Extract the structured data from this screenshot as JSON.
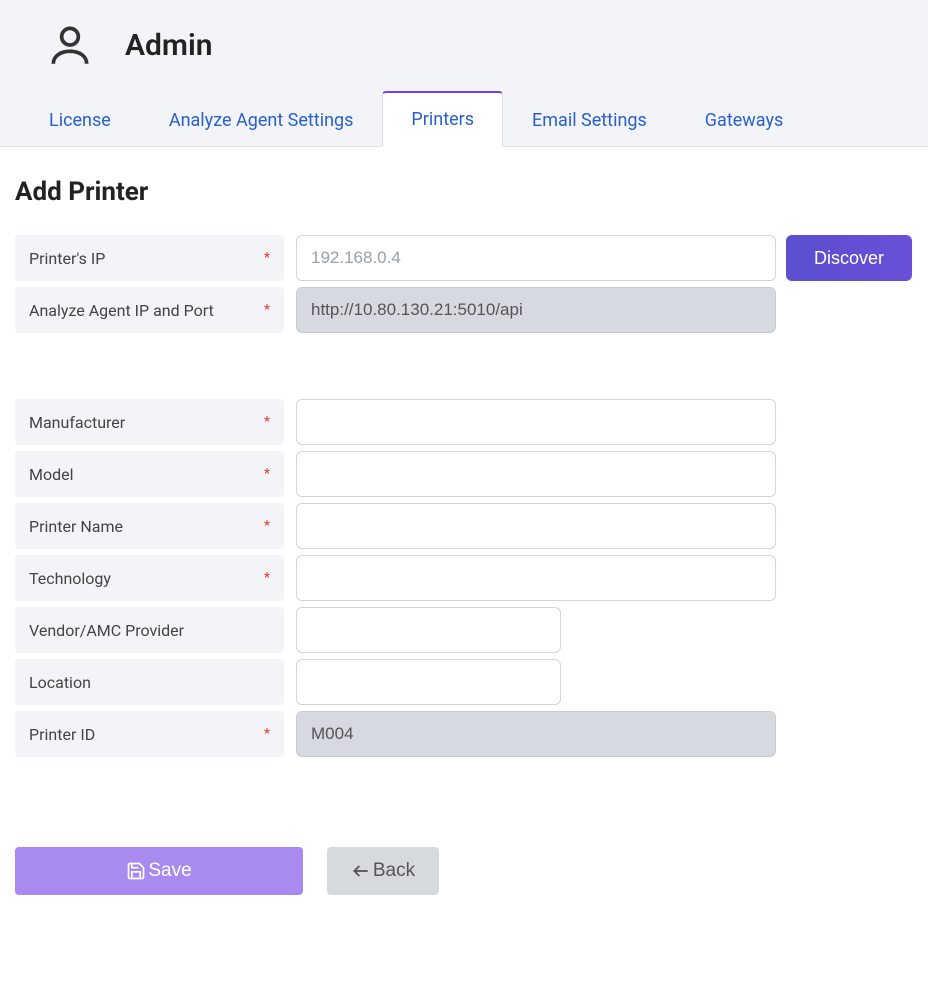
{
  "header": {
    "title": "Admin"
  },
  "tabs": [
    {
      "label": "License"
    },
    {
      "label": "Analyze Agent Settings"
    },
    {
      "label": "Printers"
    },
    {
      "label": "Email Settings"
    },
    {
      "label": "Gateways"
    }
  ],
  "form": {
    "section_title": "Add Printer",
    "labels": {
      "printer_ip": "Printer's IP",
      "agent_ip": "Analyze Agent IP and Port",
      "manufacturer": "Manufacturer",
      "model": "Model",
      "printer_name": "Printer Name",
      "technology": "Technology",
      "vendor": "Vendor/AMC Provider",
      "location": "Location",
      "printer_id": "Printer ID"
    },
    "values": {
      "printer_ip": "",
      "agent_ip": "http://10.80.130.21:5010/api",
      "manufacturer": "",
      "model": "",
      "printer_name": "",
      "technology": "",
      "vendor": "",
      "location": "",
      "printer_id": "M004"
    },
    "placeholders": {
      "printer_ip": "192.168.0.4"
    },
    "required_marker": "*"
  },
  "buttons": {
    "discover": "Discover",
    "save": "Save",
    "back": "Back"
  }
}
